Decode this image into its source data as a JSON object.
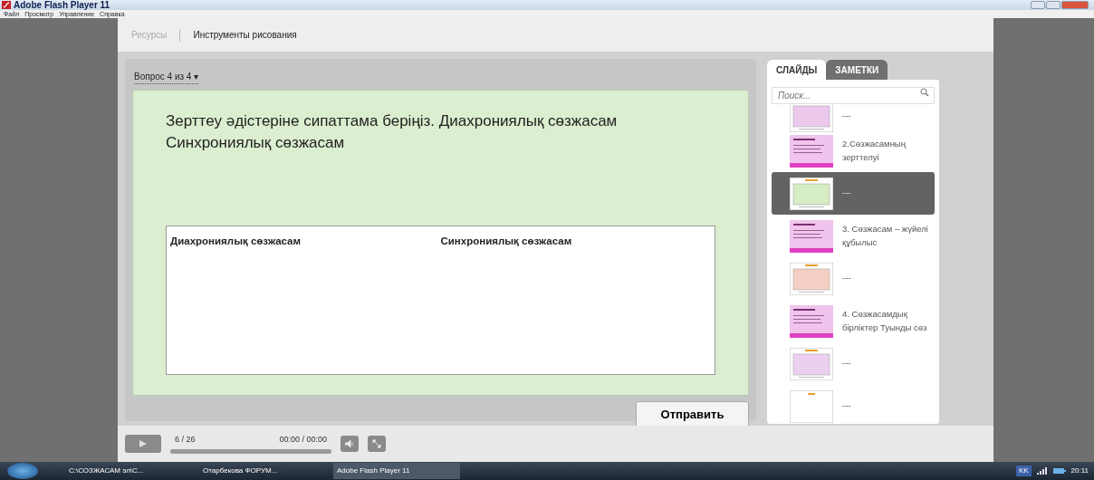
{
  "window": {
    "title": "Adobe Flash Player 11"
  },
  "menu": [
    "Файл",
    "Просмотр",
    "Управление",
    "Справка"
  ],
  "top_tabs": [
    {
      "label": "Ресурсы",
      "disabled": true
    },
    {
      "label": "Инструменты рисования",
      "disabled": false
    }
  ],
  "question": {
    "selector": "Вопрос 4 из 4",
    "selector_caret": "▾",
    "prompt": "Зерттеу әдістеріне сипаттама беріңіз. Диахрониялық сөзжасам                                Синхрониялық сөзжасам",
    "answer": {
      "column_1": "Диахрониялық сөзжасам",
      "column_2": "Синхрониялық сөзжасам"
    },
    "submit": "Отправить"
  },
  "side_tabs": [
    {
      "label": "СЛАЙДЫ",
      "selected": true
    },
    {
      "label": "ЗАМЕТКИ",
      "selected": false
    }
  ],
  "search": {
    "placeholder": "Поиск..."
  },
  "slides": [
    {
      "title": "---",
      "selected": false,
      "kind": "question",
      "color": "#ecc8ec"
    },
    {
      "title": "2.Сөзжасамның зерттелуі",
      "selected": false,
      "kind": "text",
      "color": "#f0c4ec"
    },
    {
      "title": "---",
      "selected": true,
      "kind": "question",
      "color": "#d6ecc4"
    },
    {
      "title": "3. Сөзжасам – жүйелі құбылыс",
      "selected": false,
      "kind": "text",
      "color": "#f0c4ec"
    },
    {
      "title": "---",
      "selected": false,
      "kind": "question",
      "color": "#f6cfc4"
    },
    {
      "title": "4. Сөзжасамдық бірліктер Туынды сөз",
      "selected": false,
      "kind": "text",
      "color": "#f0c4ec"
    },
    {
      "title": "---",
      "selected": false,
      "kind": "question",
      "color": "#ecd0f0"
    },
    {
      "title": "---",
      "selected": false,
      "kind": "blank"
    }
  ],
  "player": {
    "slide_counter": "6 / 26",
    "time": "00:00 / 00:00",
    "level": 0
  },
  "taskbar": {
    "items": [
      {
        "label": "C:\\СОЗЖАСАМ эл\\С...",
        "selected": false
      },
      {
        "label": "Отарбекова ФОРУМ...",
        "selected": false
      },
      {
        "label": "Adobe Flash Player 11",
        "selected": true
      }
    ],
    "language": "KK",
    "clock": "20:11"
  }
}
